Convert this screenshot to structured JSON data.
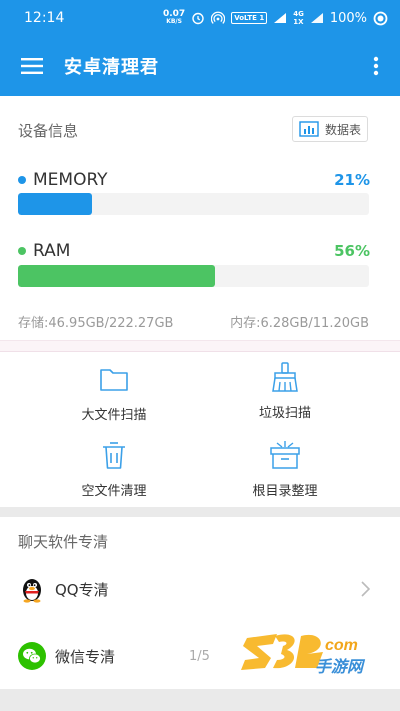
{
  "status_bar": {
    "time": "12:14",
    "net_speed": "0.07",
    "net_unit": "KB/S",
    "volte": "VoLTE 1",
    "net_type_top": "4G",
    "net_type_bottom": "1X",
    "battery": "100%"
  },
  "app_bar": {
    "title": "安卓清理君"
  },
  "device_info": {
    "title": "设备信息",
    "chart_button_label": "数据表",
    "memory": {
      "name": "MEMORY",
      "percent_text": "21%",
      "fraction": 0.21,
      "color": "#1e95e8"
    },
    "ram": {
      "name": "RAM",
      "percent_text": "56%",
      "fraction": 0.56,
      "color": "#4cc463"
    },
    "storage_text": "存储:46.95GB/222.27GB",
    "memory_text": "内存:6.28GB/11.20GB"
  },
  "tools": {
    "large_file_scan": "大文件扫描",
    "junk_scan": "垃圾扫描",
    "empty_file_clean": "空文件清理",
    "root_dir_organize": "根目录整理"
  },
  "chat_clean": {
    "title": "聊天软件专清",
    "qq_label": "QQ专清",
    "wechat_label": "微信专清",
    "pager": "1/5"
  },
  "watermark": {
    "text": "289手游网",
    "suffix": "com"
  },
  "colors": {
    "primary": "#1e95e8",
    "ram_green": "#4cc463",
    "wechat_green": "#2dc100"
  }
}
